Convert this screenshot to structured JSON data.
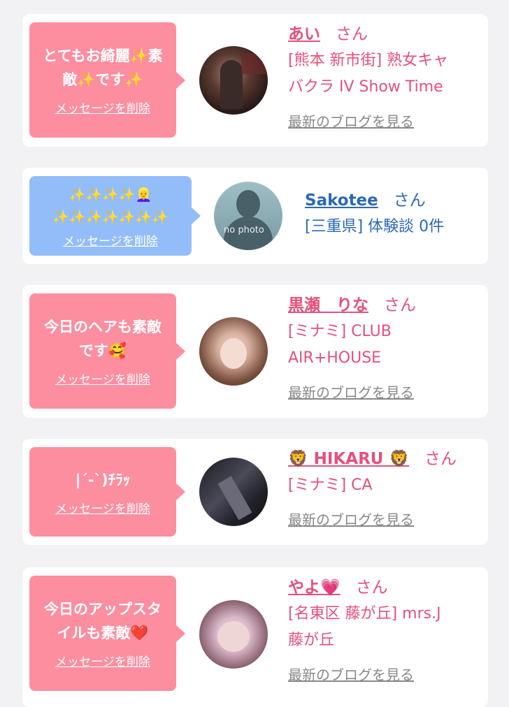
{
  "delete_label": "メッセージを削除",
  "blog_label": "最新のブログを見る",
  "honorific": "さん",
  "cards": [
    {
      "message_line1": "とてもお綺麗✨素",
      "message_line2": "敵✨です✨",
      "name": "あい",
      "shop_line1": "[熊本 新市街] 熟女キャ",
      "shop_line2": "バクラ IV Show Time"
    },
    {
      "message_line1": "✨✨✨✨👱‍♀️",
      "message_line2": "✨✨✨✨✨✨✨",
      "name": "Sakotee",
      "shop_line1": "[三重県] 体験談 0件",
      "avatar_text": "no photo"
    },
    {
      "message_line1": "今日のヘアも素敵",
      "message_line2": "です🥰",
      "name": "黒瀬　りな",
      "shop_line1": "[ミナミ] CLUB",
      "shop_line2": "AIR+HOUSE"
    },
    {
      "message_line1": "|´-`)ﾁﾗｯ",
      "name": "🦁 HIKARU 🦁",
      "shop_line1": "[ミナミ] CA"
    },
    {
      "message_line1": "今日のアップスタ",
      "message_line2": "イルも素敵❤️",
      "name": "やよ💗",
      "shop_line1": "[名東区 藤が丘] mrs.J",
      "shop_line2": "藤が丘"
    }
  ]
}
